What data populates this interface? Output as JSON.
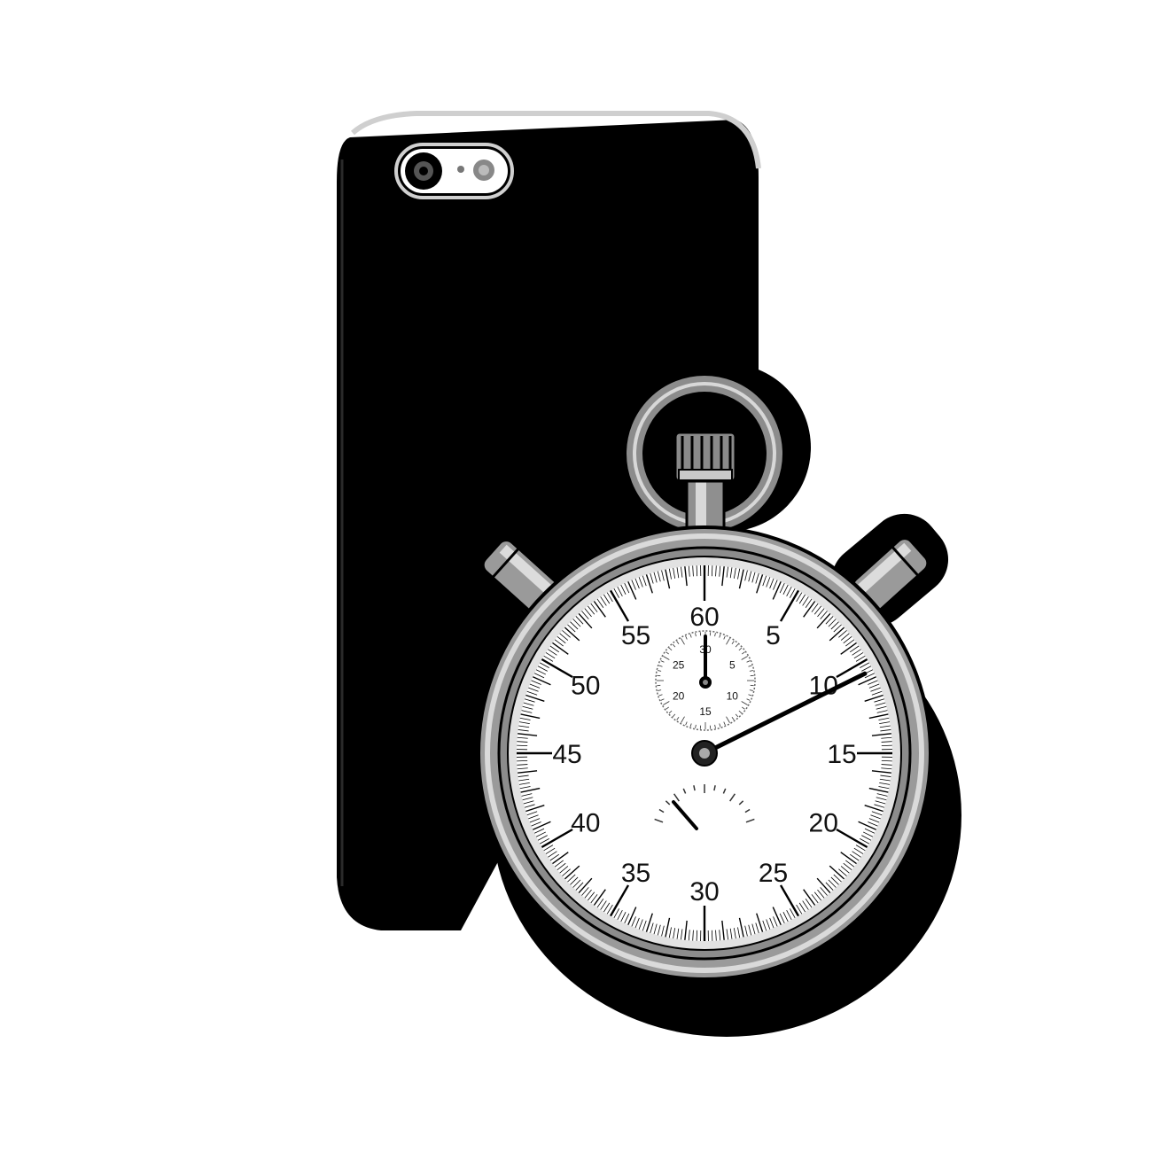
{
  "objects": {
    "phone": {
      "icon": "smartphone-back-icon",
      "color": "#000000"
    },
    "stopwatch": {
      "icon": "stopwatch-icon",
      "metal_color": "#9a9a9a",
      "face_color": "#ffffff"
    }
  },
  "dial": {
    "numbers": [
      "60",
      "5",
      "10",
      "15",
      "20",
      "25",
      "30",
      "35",
      "40",
      "45",
      "50",
      "55"
    ],
    "main_hand_seconds": 10.6
  },
  "subdial": {
    "numbers": [
      "30",
      "5",
      "10",
      "15",
      "20",
      "25"
    ],
    "hand_value": 0
  }
}
